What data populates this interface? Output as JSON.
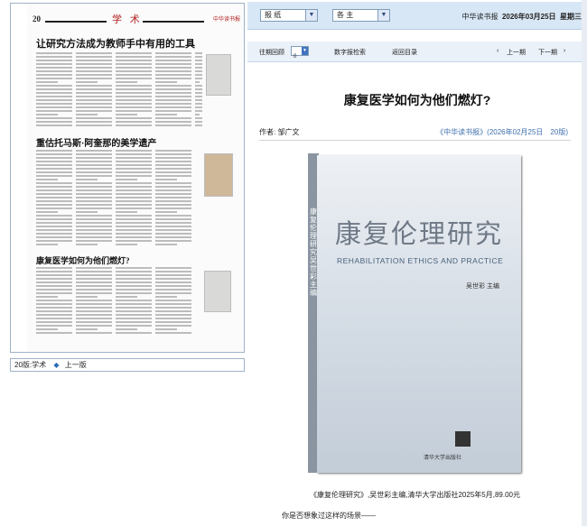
{
  "toolbar": {
    "select_newspaper": "报 纸",
    "select_edition": "各 主",
    "paper_name": "中华读书报",
    "date": "2026年03月25日",
    "weekday": "星期三"
  },
  "nav": {
    "past_issues": "往期回顾",
    "page_select": "0",
    "digital_search": "数字报检索",
    "back_to_index": "返回目录",
    "prev_issue": "上一期",
    "next_issue": "下一期",
    "prev_chevron": "‹",
    "next_chevron": "›"
  },
  "thumbnail": {
    "page_num": "20",
    "section": "学 术",
    "brand": "中华读书报",
    "headlines": [
      "让研究方法成为教师手中有用的工具",
      "重估托马斯·阿奎那的美学遗产",
      "康复医学如何为他们燃灯?"
    ]
  },
  "page_label": {
    "current": "20版:学术",
    "prev_page": "上一版"
  },
  "article": {
    "title": "康复医学如何为他们燃灯?",
    "author": "作者: 邹广文",
    "source": "《中华读书报》(2026年02月25日　20版)",
    "caption": "《康复伦理研究》,吴世彩主编,清华大学出版社2025年5月,89.00元",
    "first_line": "你是否想象过这样的场景——"
  },
  "book": {
    "title": "康复伦理研究",
    "subtitle": "REHABILITATION  ETHICS AND PRACTICE",
    "editor": "吴世彩  主编",
    "spine": "康复伦理研究 吴世彩 主编",
    "publisher": "清华大学出版社"
  }
}
